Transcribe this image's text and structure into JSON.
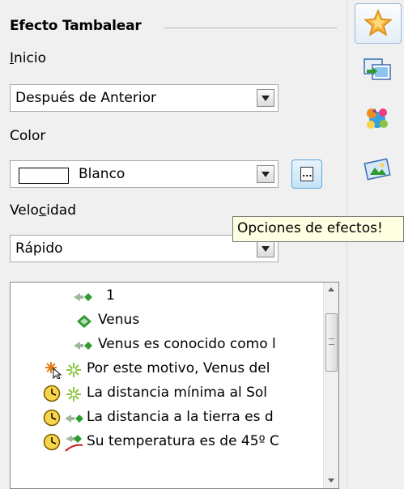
{
  "section": {
    "title": "Efecto Tambalear"
  },
  "start": {
    "label_u": "I",
    "label_rest": "nicio",
    "value": "Después de Anterior"
  },
  "color": {
    "label": "Color",
    "value": "Blanco",
    "swatch": "#ffffff"
  },
  "speed": {
    "label_a": "Velo",
    "label_u": "c",
    "label_b": "idad",
    "value": "Rápido"
  },
  "options_button": {
    "tooltip": "Opciones de efectos!"
  },
  "animation_list": {
    "items": [
      {
        "text": "1",
        "icon": "emphasis-arrow-icon"
      },
      {
        "text": "Venus",
        "icon": "group-diamond-icon"
      },
      {
        "text": "Venus es conocido como l",
        "icon": "emphasis-arrow-icon"
      },
      {
        "text": "Por este motivo, Venus del",
        "icon": "entrance-sparkle-icon",
        "trigger": "on-click-icon"
      },
      {
        "text": "La distancia mínima al Sol",
        "icon": "entrance-sparkle-icon",
        "trigger": "clock-icon"
      },
      {
        "text": "La distancia a la tierra es d",
        "icon": "emphasis-arrow-icon",
        "trigger": "clock-icon"
      },
      {
        "text": "Su temperatura es de 45º C",
        "icon": "motion-path-icon",
        "trigger": "clock-icon"
      }
    ]
  },
  "deck_tabs": [
    "custom-animation-icon",
    "slide-transition-icon",
    "gallery-icon",
    "navigator-icon"
  ],
  "colors": {
    "accent": "#5aa7d8",
    "tooltip_bg": "#ffffe1",
    "panel_bg": "#f0f0f0"
  }
}
